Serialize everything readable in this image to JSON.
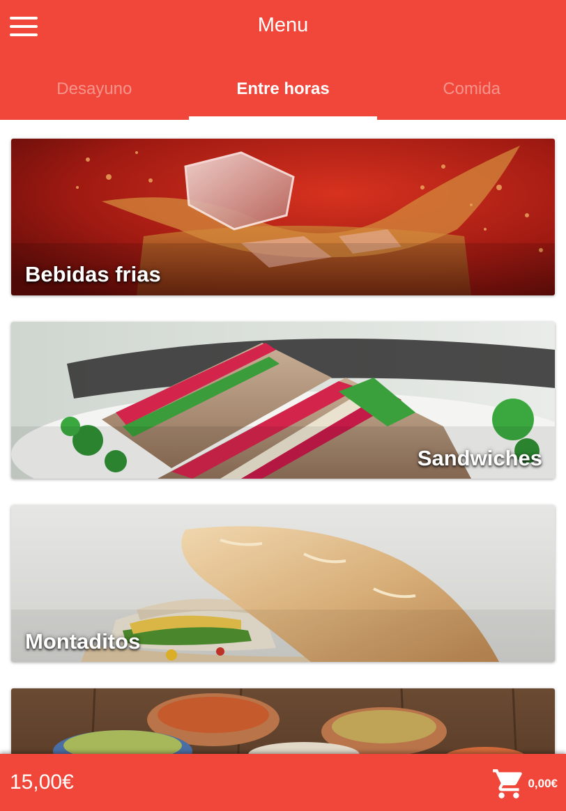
{
  "header": {
    "title": "Menu",
    "menu_icon": "hamburger-icon"
  },
  "tabs": [
    {
      "label": "Desayuno",
      "active": false
    },
    {
      "label": "Entre horas",
      "active": true
    },
    {
      "label": "Comida",
      "active": false
    }
  ],
  "categories": [
    {
      "label": "Bebidas frias",
      "image": "cold-drink-splash"
    },
    {
      "label": "Sandwiches",
      "image": "club-sandwich"
    },
    {
      "label": "Montaditos",
      "image": "baguette-sandwich"
    },
    {
      "label": "",
      "image": "tapas-bowls"
    }
  ],
  "footer": {
    "total": "15,00€",
    "cart_icon": "shopping-cart-icon",
    "cart_amount": "0,00€"
  },
  "colors": {
    "accent": "#f0473a",
    "text_on_accent": "#ffffff"
  }
}
